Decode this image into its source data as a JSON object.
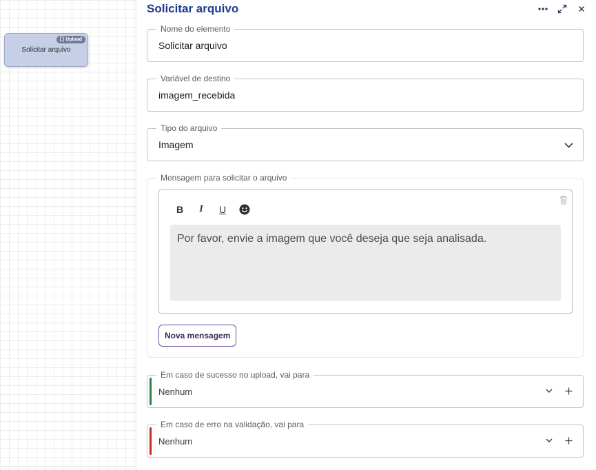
{
  "canvas": {
    "node": {
      "badge": "Upload",
      "label": "Solicitar arquivo"
    }
  },
  "panel": {
    "title": "Solicitar arquivo",
    "icons": {
      "more": "more-horizontal-icon",
      "expand": "expand-icon",
      "close": "close-icon"
    },
    "fields": {
      "element_name": {
        "label": "Nome do elemento",
        "value": "Solicitar arquivo"
      },
      "target_variable": {
        "label": "Variável de destino",
        "value": "imagem_recebida"
      },
      "file_type": {
        "label": "Tipo do arquivo",
        "value": "Imagem"
      }
    },
    "message": {
      "label": "Mensagem para solicitar o arquivo",
      "toolbar": {
        "bold": "B",
        "italic": "I",
        "underline": "U",
        "emoji": "emoji-icon"
      },
      "text": "Por favor, envie a imagem que você deseja que seja analisada.",
      "new_message_button": "Nova mensagem"
    },
    "on_success": {
      "label": "Em caso de sucesso no upload, vai para",
      "value": "Nenhum",
      "accent": "#2e7d4f"
    },
    "on_error": {
      "label": "Em caso de erro na validação, vai para",
      "value": "Nenhum",
      "accent": "#c62828"
    }
  }
}
